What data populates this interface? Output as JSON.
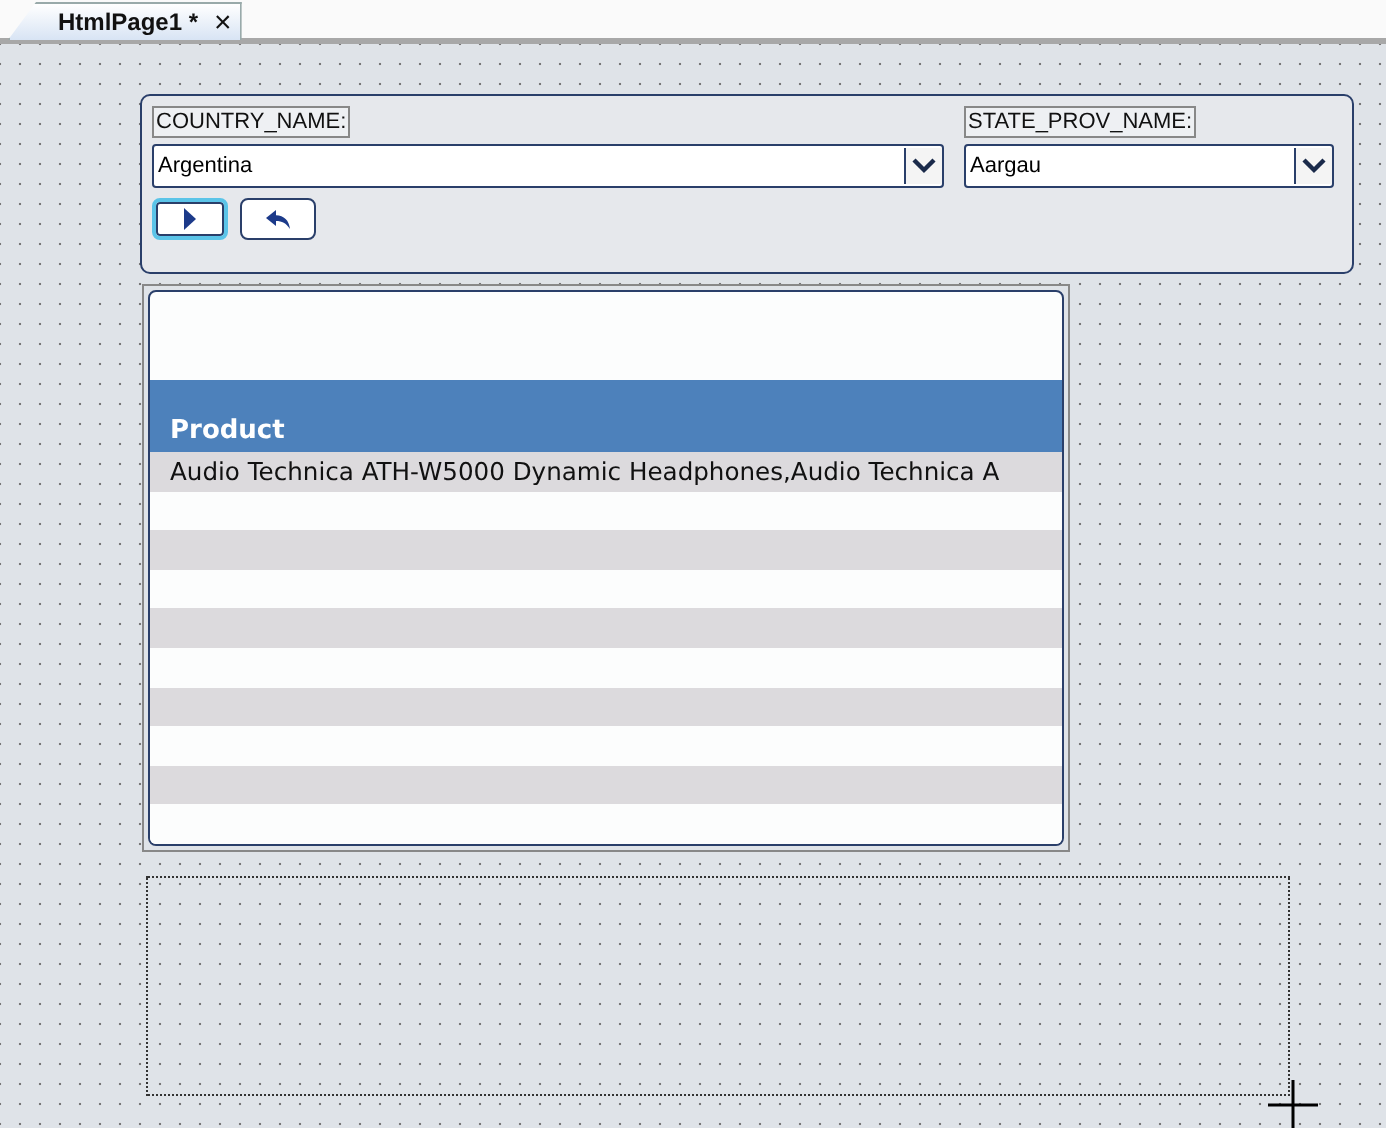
{
  "tabs": [
    {
      "label": "HtmlPage1 *",
      "close": "×",
      "selected": true
    }
  ],
  "filters": [
    {
      "label": "COUNTRY_NAME:",
      "value": "Argentina"
    },
    {
      "label": "STATE_PROV_NAME:",
      "value": "Aargau"
    }
  ],
  "buttons": [
    {
      "kind": "run",
      "focused": true
    },
    {
      "kind": "undo",
      "focused": false
    }
  ],
  "grid": {
    "columns": [
      "Product"
    ],
    "rows": [
      [
        "Audio Technica ATH-W5000 Dynamic Headphones,Audio Technica A"
      ]
    ]
  }
}
